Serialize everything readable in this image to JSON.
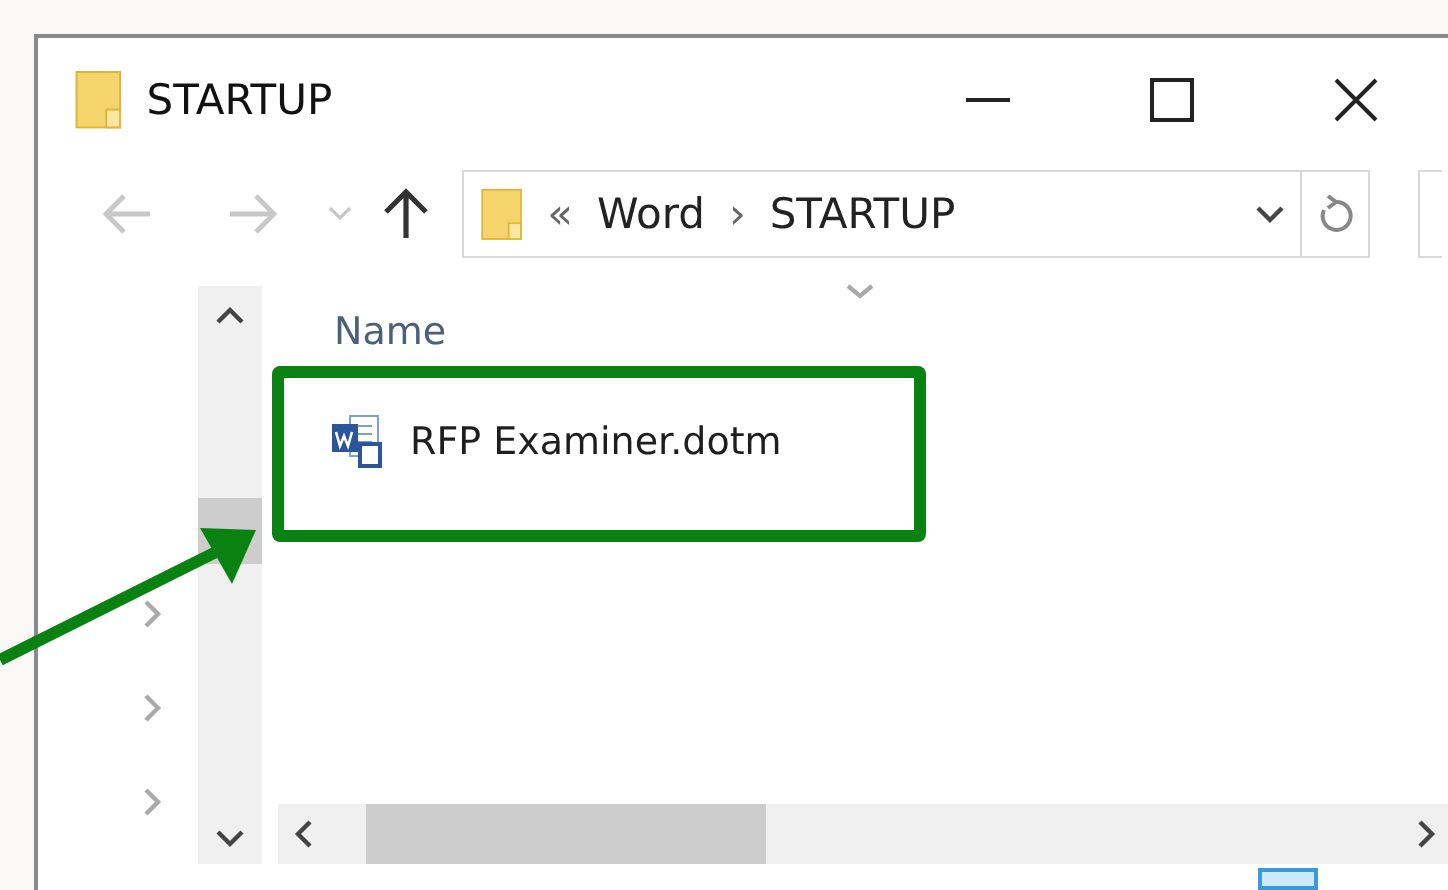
{
  "window": {
    "title": "STARTUP"
  },
  "nav_buttons": [
    {
      "kind": "back",
      "disabled": true
    },
    {
      "kind": "forward",
      "disabled": true
    },
    {
      "kind": "recent",
      "disabled": true
    },
    {
      "kind": "up",
      "disabled": false
    }
  ],
  "address": {
    "overflow": "«",
    "parts": [
      "Word",
      "STARTUP"
    ],
    "separator": "›"
  },
  "columns": [
    {
      "label": "Name"
    }
  ],
  "files": [
    {
      "name": "RFP Examiner.dotm",
      "highlighted": true
    }
  ],
  "annotation_arrow": true
}
